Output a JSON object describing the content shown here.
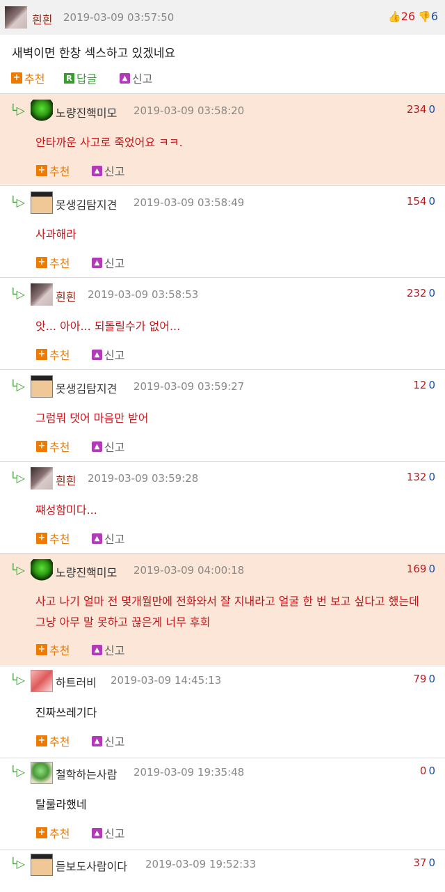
{
  "post": {
    "nickname": "흰흰",
    "date": "2019-03-09 03:57:50",
    "likes": "26",
    "dislikes": "6",
    "text": "새벽이면 한창 섹스하고 있겠네요",
    "actions": {
      "recommend": "추천",
      "reply": "답글",
      "report": "신고"
    }
  },
  "comments": [
    {
      "nickname": "노량진핵미모",
      "date": "2019-03-09 03:58:20",
      "up": "234",
      "down": "0",
      "text": "안타까운 사고로 죽었어요 ㅋㅋ."
    },
    {
      "nickname": "못생김탐지견",
      "date": "2019-03-09 03:58:49",
      "up": "154",
      "down": "0",
      "text": "사과해라"
    },
    {
      "nickname": "흰흰",
      "date": "2019-03-09 03:58:53",
      "up": "232",
      "down": "0",
      "text": "앗... 아아... 되돌릴수가 없어..."
    },
    {
      "nickname": "못생김탐지견",
      "date": "2019-03-09 03:59:27",
      "up": "12",
      "down": "0",
      "text": "그럼뭐 댓어 마음만 받어"
    },
    {
      "nickname": "흰흰",
      "date": "2019-03-09 03:59:28",
      "up": "132",
      "down": "0",
      "text": "쨰성함미다..."
    },
    {
      "nickname": "노량진핵미모",
      "date": "2019-03-09 04:00:18",
      "up": "169",
      "down": "0",
      "text": "사고 나기 얼마 전 몇개월만에 전화와서 잘 지내라고 얼굴 한 번 보고 싶다고 했는데 그냥 아무 말 못하고 끊은게 너무 후회"
    },
    {
      "nickname": "하트러비",
      "date": "2019-03-09 14:45:13",
      "up": "79",
      "down": "0",
      "text": "진짜쓰레기다"
    },
    {
      "nickname": "철학하는사람",
      "date": "2019-03-09 19:35:48",
      "up": "0",
      "down": "0",
      "text": "탈룰라했네"
    },
    {
      "nickname": "듣보도사람이다",
      "date": "2019-03-09 19:52:33",
      "up": "37",
      "down": "0",
      "text": ""
    }
  ],
  "comment_actions": {
    "recommend": "추천",
    "report": "신고"
  },
  "glyphs": {
    "reply_arrow": "└▷",
    "thumb_up": "👍",
    "thumb_down": "👎",
    "plus": "+",
    "r": "R",
    "siren": "▲"
  },
  "colors": {
    "highlight": "#fbe6d7",
    "author": "#8a1f11",
    "comment_text": "#c4161c",
    "recommend": "#ee7a00",
    "reply": "#3a9b32",
    "report_badge": "#b03ab7",
    "dislike": "#1f4aa8"
  }
}
